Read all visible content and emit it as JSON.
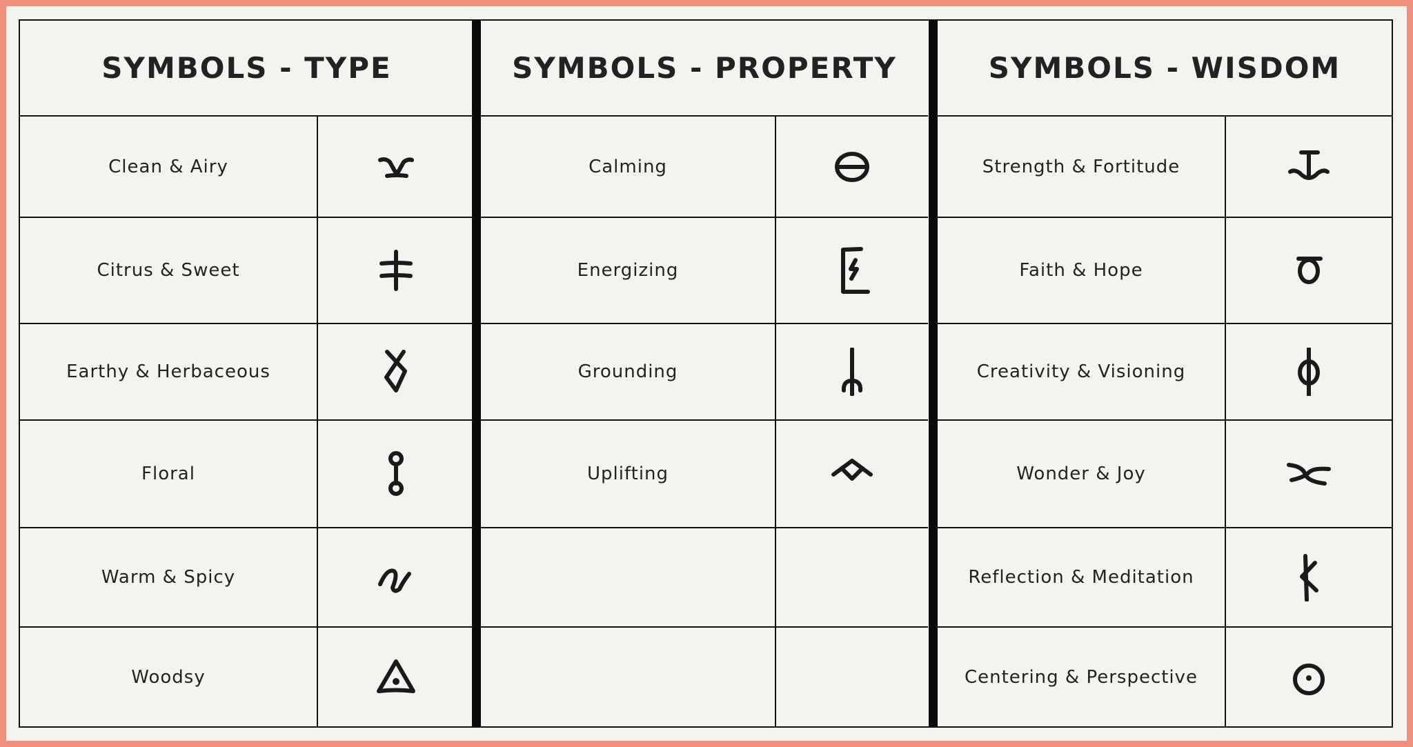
{
  "colors": {
    "frame": "#EF8F7E",
    "background": "#F3F3EF",
    "ink": "#1A1A1A"
  },
  "sections": [
    {
      "title": "SYMBOLS - TYPE",
      "rows": [
        {
          "label": "Clean & Airy",
          "symbol": "forked-v-glyph"
        },
        {
          "label": "Citrus & Sweet",
          "symbol": "double-cross-glyph"
        },
        {
          "label": "Earthy & Herbaceous",
          "symbol": "crossed-diamond-glyph"
        },
        {
          "label": "Floral",
          "symbol": "linked-circles-glyph"
        },
        {
          "label": "Warm & Spicy",
          "symbol": "wave-glyph"
        },
        {
          "label": "Woodsy",
          "symbol": "dotted-triangle-glyph"
        }
      ]
    },
    {
      "title": "SYMBOLS - PROPERTY",
      "rows": [
        {
          "label": "Calming",
          "symbol": "theta-circle-glyph"
        },
        {
          "label": "Energizing",
          "symbol": "bracket-lightning-glyph"
        },
        {
          "label": "Grounding",
          "symbol": "root-trident-glyph"
        },
        {
          "label": "Uplifting",
          "symbol": "winged-diamond-glyph"
        },
        {
          "label": "",
          "symbol": ""
        },
        {
          "label": "",
          "symbol": ""
        }
      ]
    },
    {
      "title": "SYMBOLS - WISDOM",
      "rows": [
        {
          "label": "Strength & Fortitude",
          "symbol": "anchor-glyph"
        },
        {
          "label": "Faith & Hope",
          "symbol": "capped-circle-glyph"
        },
        {
          "label": "Creativity & Visioning",
          "symbol": "phi-glyph"
        },
        {
          "label": "Wonder & Joy",
          "symbol": "crossing-curves-glyph"
        },
        {
          "label": "Reflection & Meditation",
          "symbol": "branch-glyph"
        },
        {
          "label": "Centering & Perspective",
          "symbol": "circled-dot-glyph"
        }
      ]
    }
  ]
}
